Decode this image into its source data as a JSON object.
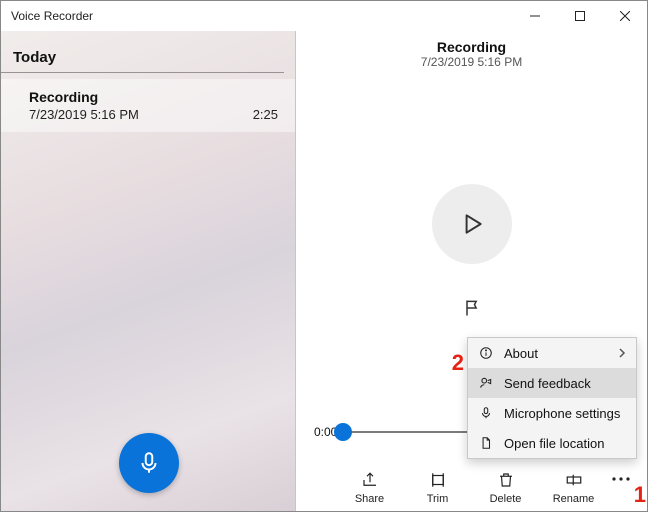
{
  "window": {
    "title": "Voice Recorder"
  },
  "sidebar": {
    "section": "Today",
    "items": [
      {
        "title": "Recording",
        "subtitle": "7/23/2019 5:16 PM",
        "duration": "2:25"
      }
    ]
  },
  "player": {
    "title": "Recording",
    "subtitle": "7/23/2019 5:16 PM",
    "time_current": "0:00"
  },
  "bottombar": {
    "share": "Share",
    "trim": "Trim",
    "delete": "Delete",
    "rename": "Rename"
  },
  "menu": {
    "about": "About",
    "send_feedback": "Send feedback",
    "microphone_settings": "Microphone settings",
    "open_file_location": "Open file location"
  },
  "annotations": {
    "one": "1",
    "two": "2"
  },
  "colors": {
    "accent": "#0a73d9",
    "annotation": "#e52314"
  }
}
